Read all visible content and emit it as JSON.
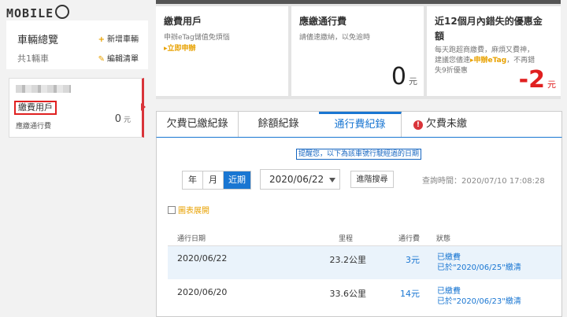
{
  "brand": {
    "logo": "MOBILE"
  },
  "sidebar": {
    "summary_title": "車輛總覽",
    "vehicle_count": "共1輛車",
    "add_vehicle": "新增車輛",
    "edit_list": "編輯清單"
  },
  "vehicle_card": {
    "account_type": "繳費用戶",
    "due_label": "應繳通行費",
    "due_amount": "0",
    "unit": "元"
  },
  "cards": {
    "account": {
      "title": "繳費用戶",
      "desc": "申辦eTag儲值免煩惱",
      "link": "▸立即申辦"
    },
    "due": {
      "title": "應繳通行費",
      "desc": "請儘速繳納，以免逾時",
      "amount": "0",
      "unit": "元"
    },
    "missed": {
      "title_line1": "近12個月內錯失的優惠金",
      "title_line2": "額",
      "desc_line1": "每天跑超商繳費，麻煩又費神，",
      "desc_line2_a": "建議您儘速",
      "desc_line2_link": "▸申辦eTag",
      "desc_line2_b": "，不再錯",
      "desc_line3": "失9折優惠",
      "amount": "-2",
      "unit": "元"
    }
  },
  "tabs": [
    {
      "label": "欠費已繳紀錄"
    },
    {
      "label": "餘額紀錄"
    },
    {
      "label": "通行費紀錄"
    },
    {
      "label": "欠費未繳"
    }
  ],
  "toolbar": {
    "notice": "提醒您，以下為該車號行駛經過的日期",
    "period_options": [
      "年",
      "月",
      "近期"
    ],
    "selected_date": "2020/06/22",
    "advanced_search": "進階搜尋",
    "query_time": "查詢時間：2020/07/10 17:08:28",
    "chart_toggle": "圖表展開"
  },
  "table": {
    "headers": {
      "date": "通行日期",
      "mileage": "里程",
      "fee": "通行費",
      "status": "狀態"
    },
    "rows": [
      {
        "date": "2020/06/22",
        "mileage": "23.2公里",
        "fee": "3元",
        "status": "已繳費",
        "paid_on": "已於\"2020/06/25\"繳清"
      },
      {
        "date": "2020/06/20",
        "mileage": "33.6公里",
        "fee": "14元",
        "status": "已繳費",
        "paid_on": "已於\"2020/06/23\"繳清"
      }
    ]
  }
}
